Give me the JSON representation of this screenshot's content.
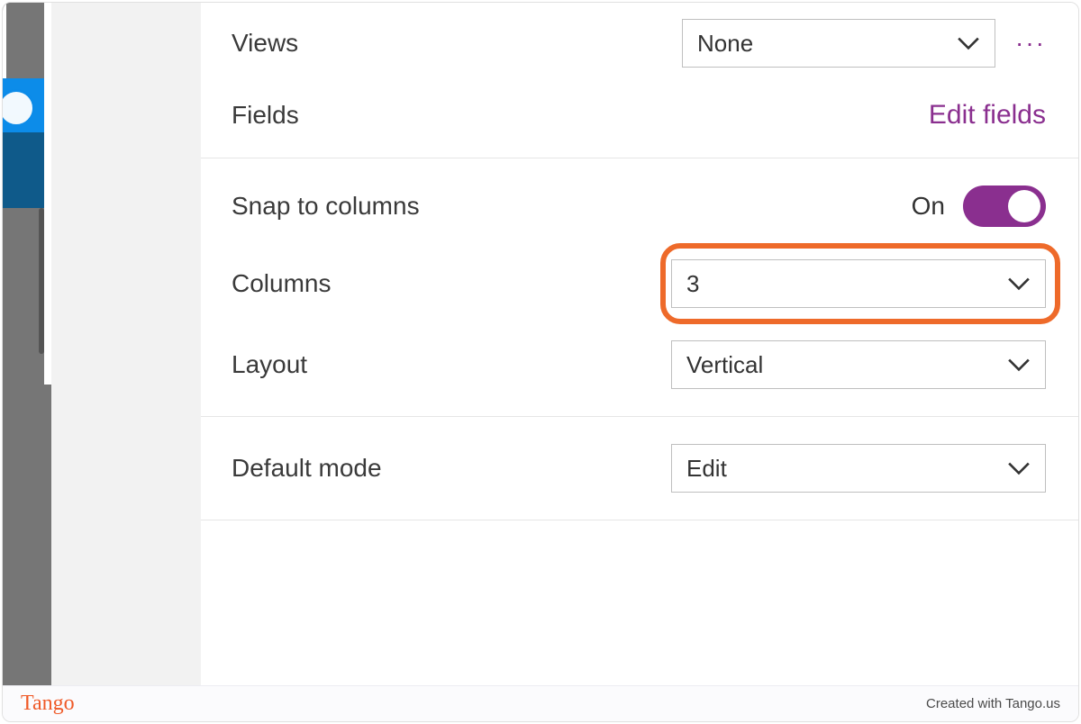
{
  "panel": {
    "views": {
      "label": "Views",
      "value": "None"
    },
    "fields": {
      "label": "Fields",
      "action": "Edit fields"
    },
    "snap": {
      "label": "Snap to columns",
      "state": "On"
    },
    "columns": {
      "label": "Columns",
      "value": "3"
    },
    "layout": {
      "label": "Layout",
      "value": "Vertical"
    },
    "defaultMode": {
      "label": "Default mode",
      "value": "Edit"
    },
    "more": "···"
  },
  "footer": {
    "brand": "Tango",
    "credit": "Created with Tango.us"
  }
}
